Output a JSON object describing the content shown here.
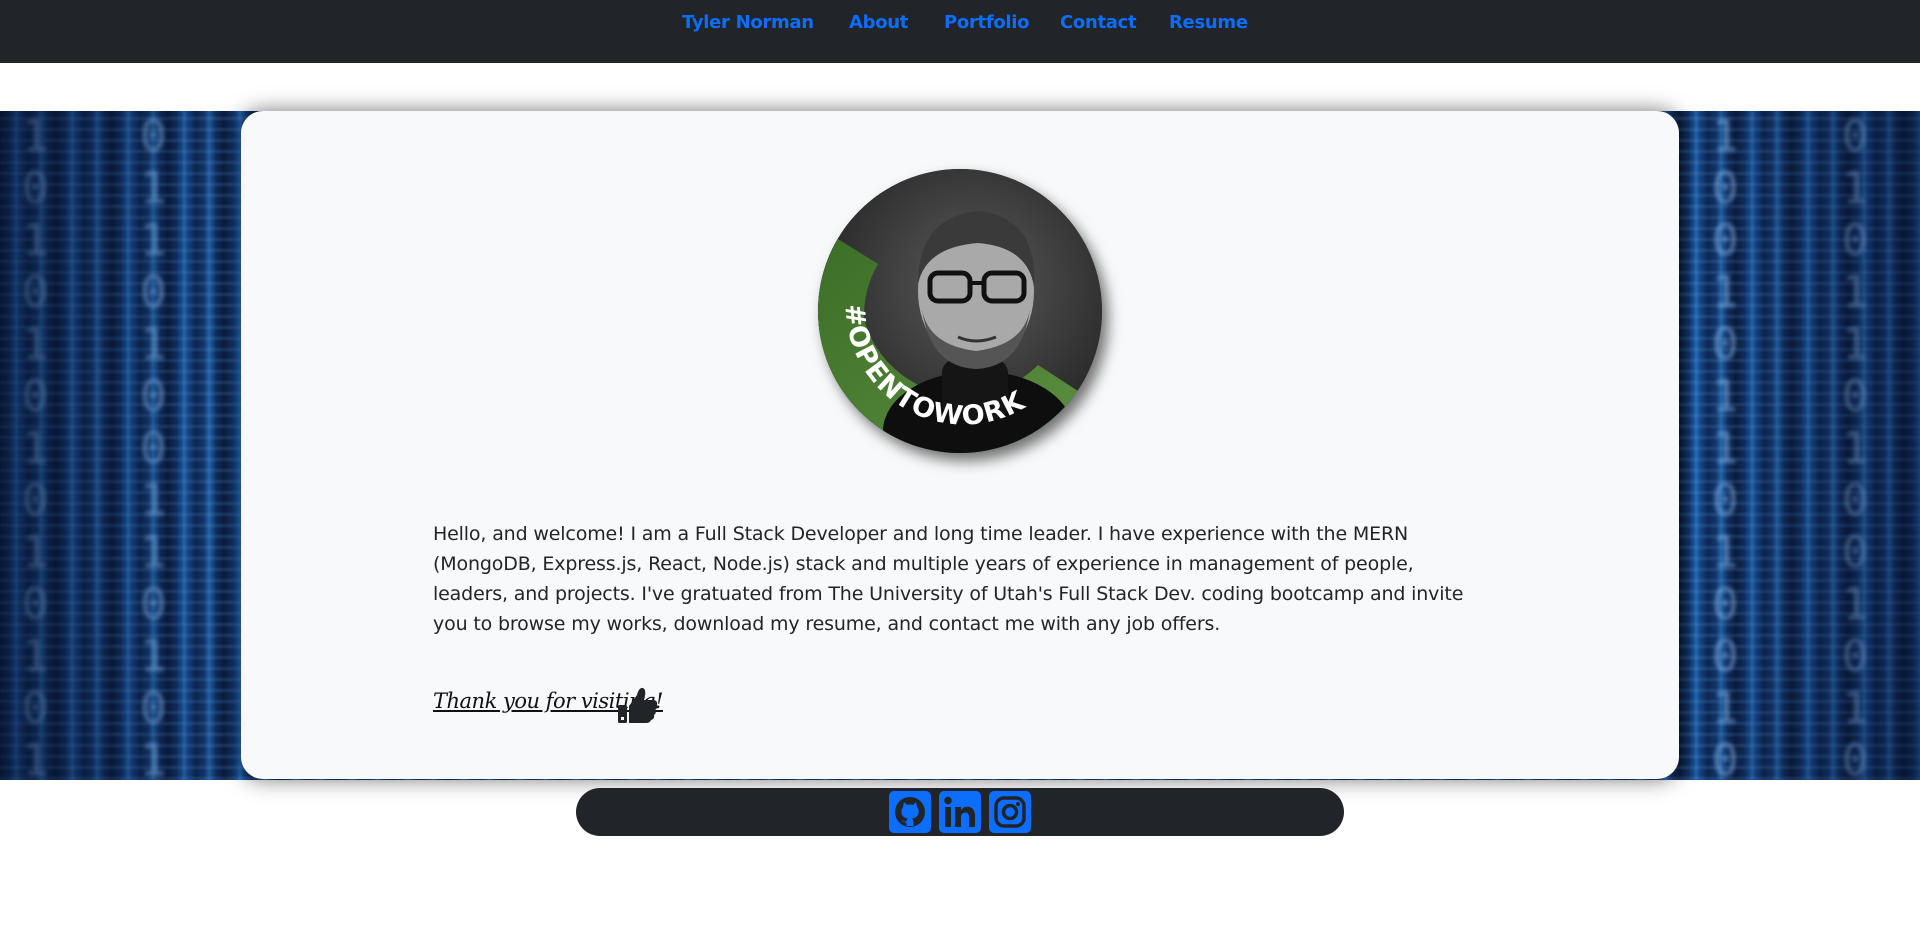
{
  "nav": {
    "brand": "Tyler Norman",
    "links": [
      "About",
      "Portfolio",
      "Contact",
      "Resume"
    ]
  },
  "profile": {
    "badge_text": "#OPENTOWORK"
  },
  "about": {
    "welcome_text": "Hello, and welcome! I am a Full Stack Developer and long time leader. I have experience with the MERN (MongoDB, Express.js, React, Node.js) stack and multiple years of experience in management of people, leaders, and projects. I've gratuated from The University of Utah's Full Stack Dev. coding bootcamp and invite you to browse my works, download my resume, and contact me with any job offers.",
    "thanks_text": "Thank you for visiting!"
  },
  "footer": {
    "icons": [
      "github-icon",
      "linkedin-icon",
      "instagram-icon"
    ]
  },
  "colors": {
    "navbar_bg": "#212529",
    "link_blue": "#0d6efd",
    "card_bg": "#f8f9fa",
    "badge_green": "#4a7a33"
  }
}
